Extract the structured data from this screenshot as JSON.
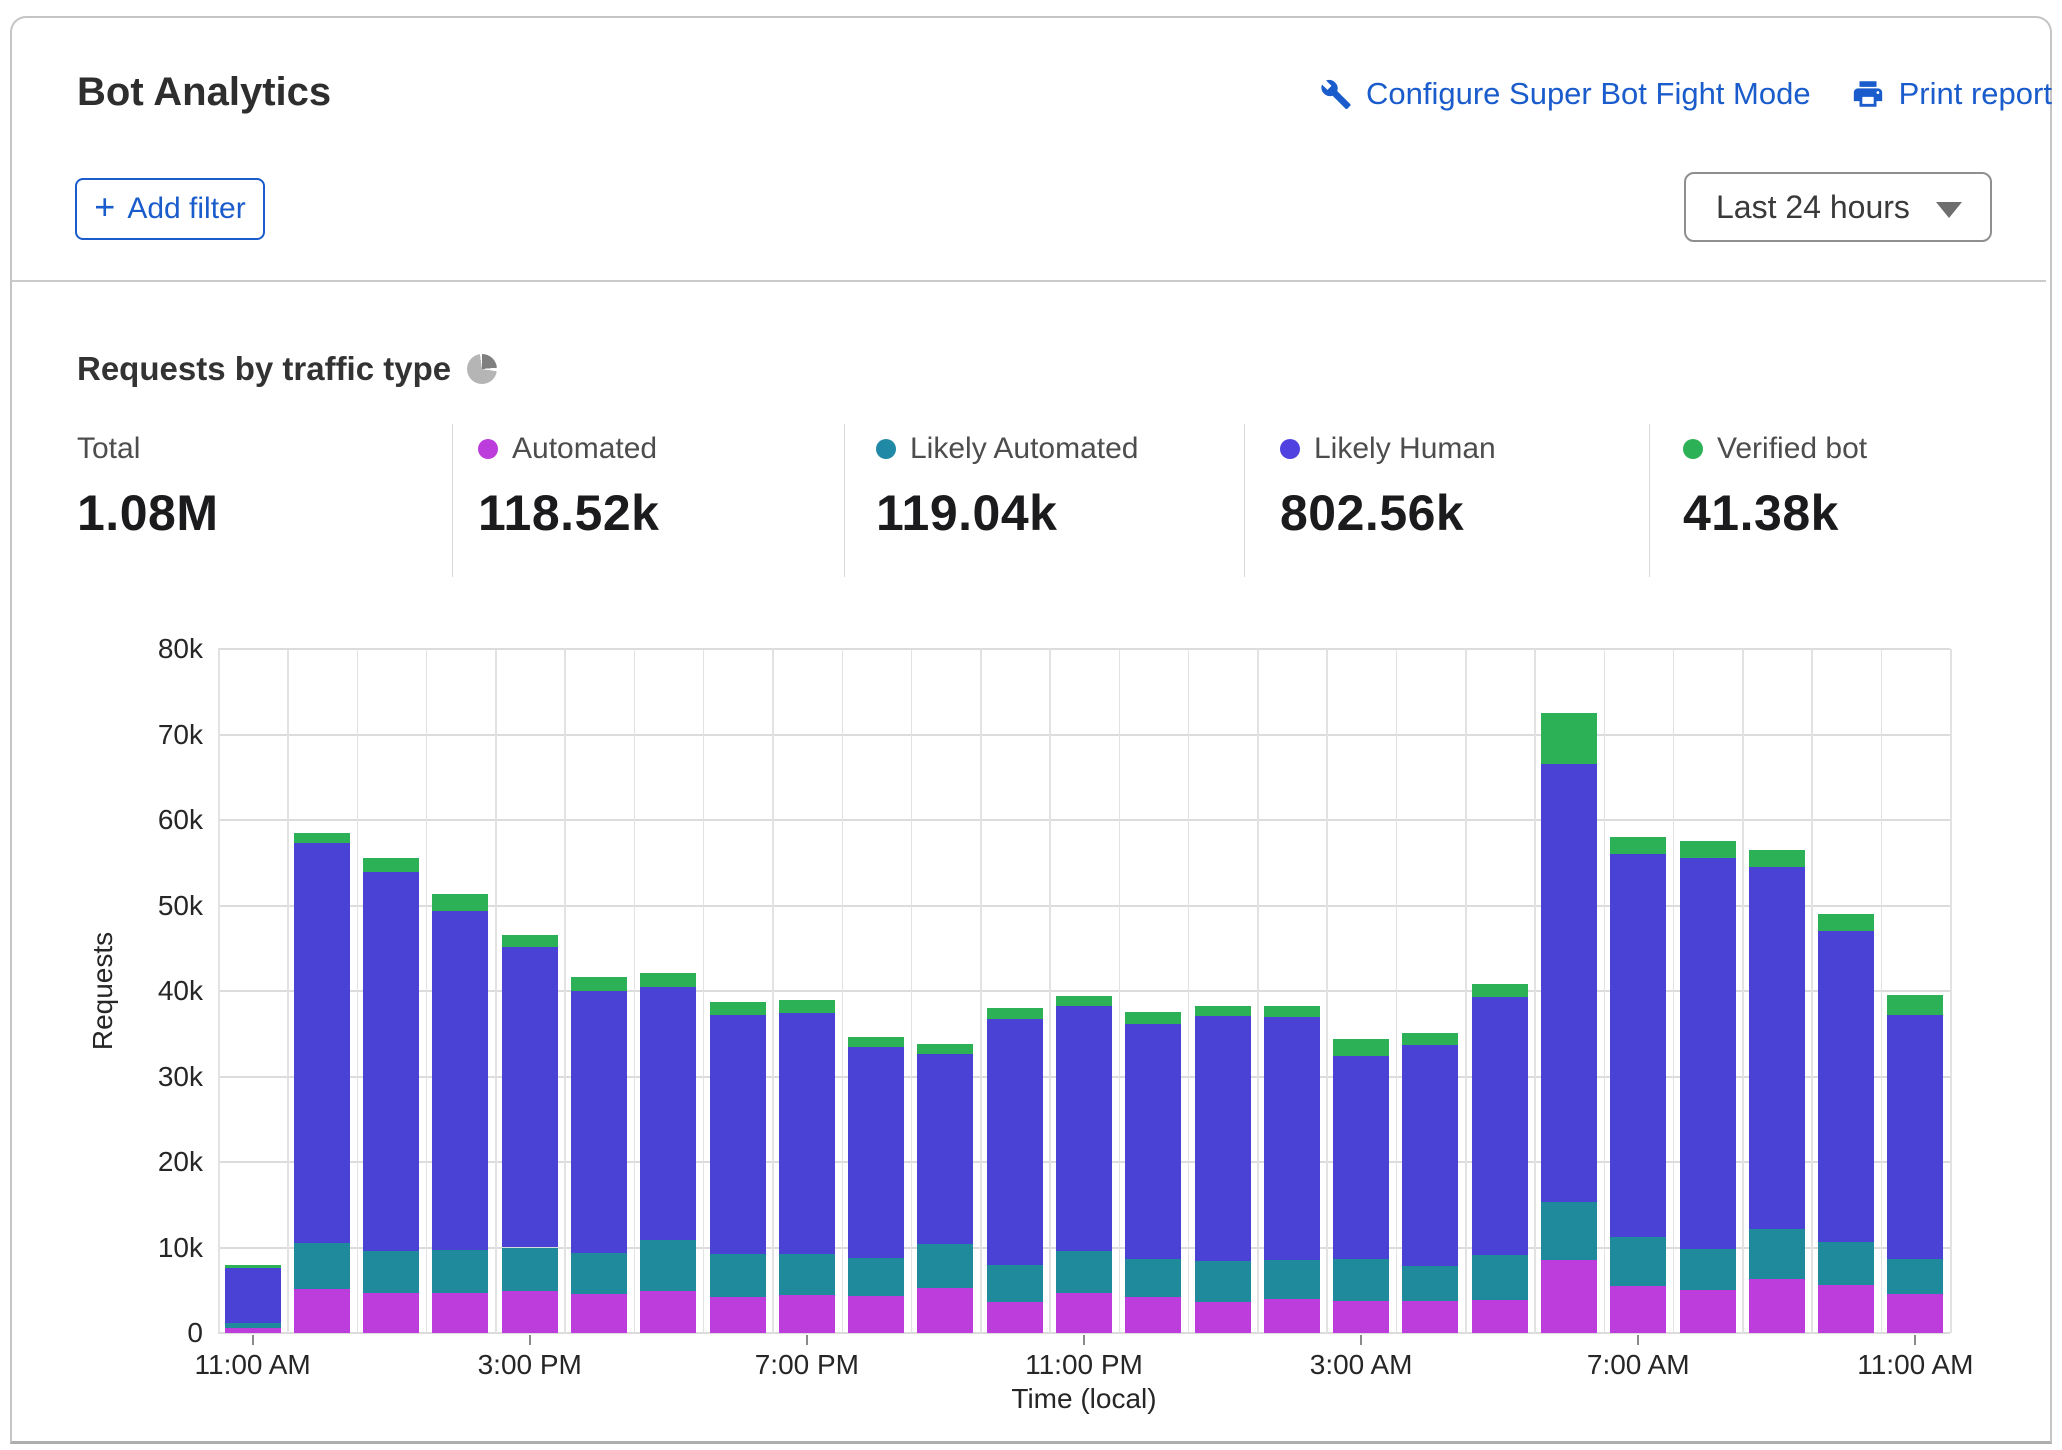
{
  "header": {
    "title": "Bot Analytics",
    "configure_label": "Configure Super Bot Fight Mode",
    "print_label": "Print report",
    "add_filter_label": "Add filter",
    "add_filter_plus": "+",
    "time_range_value": "Last 24 hours",
    "link_color": "#1a5ccb"
  },
  "section": {
    "heading": "Requests by traffic type"
  },
  "stats": [
    {
      "label": "Total",
      "value": "1.08M",
      "color": null
    },
    {
      "label": "Automated",
      "value": "118.52k",
      "color": "#bc3ddb"
    },
    {
      "label": "Likely Automated",
      "value": "119.04k",
      "color": "#2089a5"
    },
    {
      "label": "Likely Human",
      "value": "802.56k",
      "color": "#4f42e0"
    },
    {
      "label": "Verified bot",
      "value": "41.38k",
      "color": "#2db157"
    }
  ],
  "chart_data": {
    "type": "bar",
    "stacked": true,
    "title": "Requests by traffic type",
    "xlabel": "Time (local)",
    "ylabel": "Requests",
    "ylim": [
      0,
      80000
    ],
    "ytick_step": 10000,
    "grid": true,
    "categories": [
      "11:00 AM",
      "12:00 PM",
      "1:00 PM",
      "2:00 PM",
      "3:00 PM",
      "4:00 PM",
      "5:00 PM",
      "6:00 PM",
      "7:00 PM",
      "8:00 PM",
      "9:00 PM",
      "10:00 PM",
      "11:00 PM",
      "12:00 AM",
      "1:00 AM",
      "2:00 AM",
      "3:00 AM",
      "4:00 AM",
      "5:00 AM",
      "6:00 AM",
      "7:00 AM",
      "8:00 AM",
      "9:00 AM",
      "10:00 AM",
      "11:00 AM"
    ],
    "xtick_label_every": 4,
    "series": [
      {
        "name": "Automated",
        "color": "#bc3ddb",
        "values": [
          600,
          5200,
          4700,
          4700,
          4900,
          4600,
          4900,
          4200,
          4500,
          4300,
          5300,
          3600,
          4700,
          4200,
          3600,
          4000,
          3800,
          3700,
          3900,
          8500,
          5500,
          5000,
          6300,
          5600,
          4600
        ]
      },
      {
        "name": "Likely Automated",
        "color": "#1e8a9c",
        "values": [
          600,
          5300,
          4900,
          5000,
          5100,
          4700,
          6000,
          5000,
          4700,
          4500,
          5100,
          4400,
          4900,
          4400,
          4800,
          4500,
          4900,
          4100,
          5200,
          6800,
          5700,
          4800,
          5900,
          5100,
          4100
        ]
      },
      {
        "name": "Likely Human",
        "color": "#4a42d4",
        "values": [
          6400,
          46800,
          44300,
          39700,
          35200,
          30700,
          29600,
          28000,
          28200,
          24600,
          22200,
          28700,
          28600,
          27500,
          28700,
          28500,
          23700,
          25900,
          30200,
          51200,
          44800,
          45700,
          42300,
          36300,
          28500
        ]
      },
      {
        "name": "Verified bot",
        "color": "#2db157",
        "values": [
          400,
          1200,
          1700,
          1900,
          1400,
          1600,
          1600,
          1500,
          1500,
          1200,
          1200,
          1300,
          1200,
          1400,
          1200,
          1300,
          2000,
          1400,
          1500,
          6000,
          2000,
          2000,
          2000,
          2000,
          2300
        ]
      }
    ]
  }
}
